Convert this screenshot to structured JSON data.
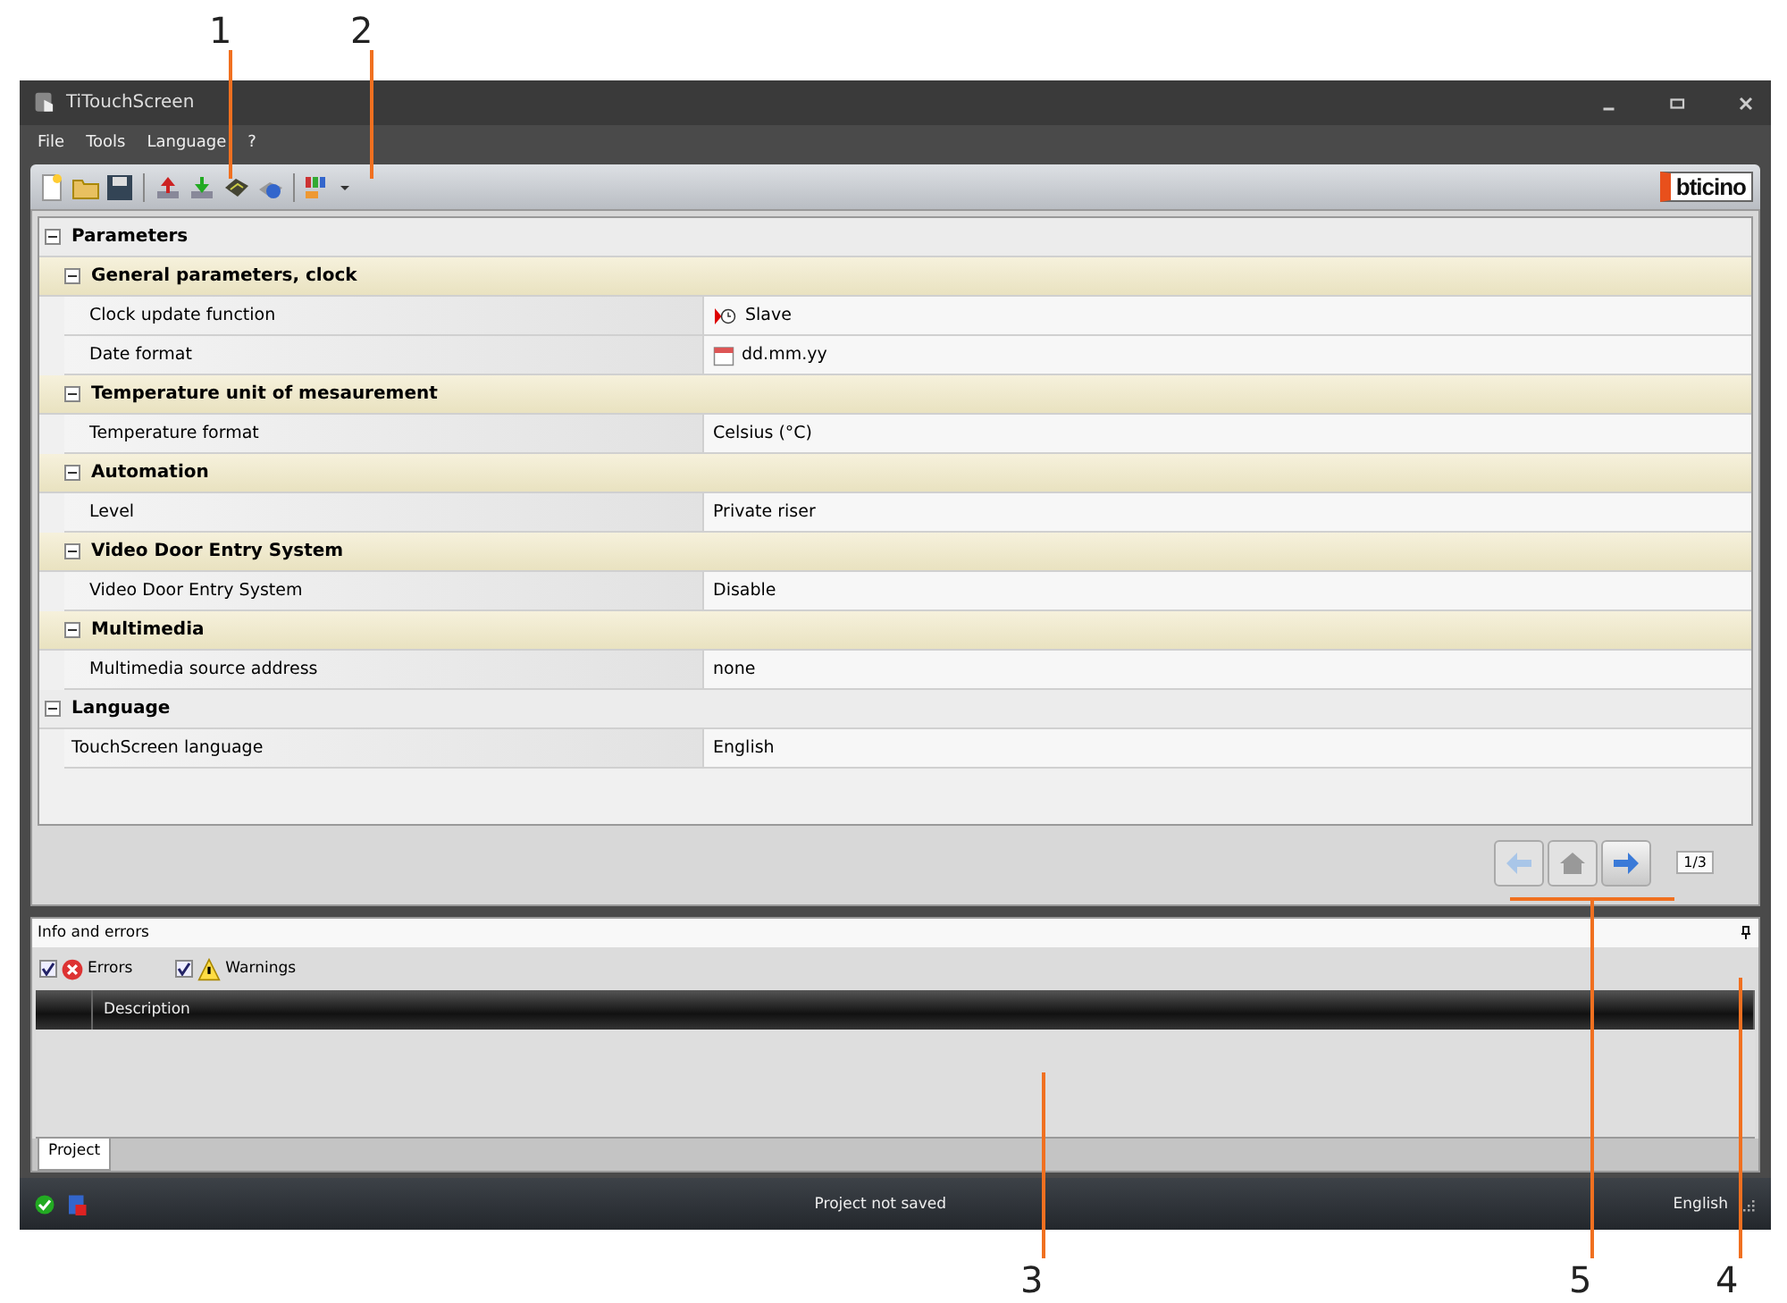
{
  "callouts": [
    {
      "label": "1"
    },
    {
      "label": "2"
    },
    {
      "label": "3"
    },
    {
      "label": "5"
    },
    {
      "label": "4"
    }
  ],
  "window": {
    "title": "TiTouchScreen"
  },
  "menu": [
    "File",
    "Tools",
    "Language",
    "?"
  ],
  "logo": "bticino",
  "grid": {
    "label": "Parameters",
    "expanded": true,
    "groups": [
      {
        "label": "General parameters, clock",
        "expanded": true,
        "rows": [
          {
            "name": "Clock update function",
            "value": "Slave",
            "kind": "clock"
          },
          {
            "name": "Date format",
            "value": "dd.mm.yy",
            "kind": "calendar"
          }
        ]
      },
      {
        "label": "Temperature unit of mesaurement",
        "expanded": true,
        "rows": [
          {
            "name": "Temperature format",
            "value": "Celsius (°C)"
          }
        ]
      },
      {
        "label": "Automation",
        "expanded": true,
        "rows": [
          {
            "name": "Level",
            "value": "Private riser"
          }
        ]
      },
      {
        "label": "Video Door Entry System",
        "expanded": true,
        "rows": [
          {
            "name": "Video Door Entry System",
            "value": "Disable"
          }
        ]
      },
      {
        "label": "Multimedia",
        "expanded": true,
        "rows": [
          {
            "name": "Multimedia source address",
            "value": "none"
          }
        ]
      }
    ]
  },
  "language_section": {
    "label": "Language",
    "expanded": true,
    "rows": [
      {
        "name": "TouchScreen language",
        "value": "English"
      }
    ]
  },
  "nav": {
    "back_disabled": true,
    "home_disabled": true,
    "forward_disabled": false,
    "page": "1/3"
  },
  "info_panel": {
    "title": "Info and errors",
    "filters": [
      {
        "label": "Errors",
        "kind": "error",
        "checked": true
      },
      {
        "label": "Warnings",
        "kind": "warning",
        "checked": true
      }
    ],
    "columns": [
      "Description"
    ],
    "tabs": [
      {
        "label": "Project",
        "selected": true
      }
    ]
  },
  "status_bar": {
    "message": "Project not saved",
    "language": "English"
  }
}
